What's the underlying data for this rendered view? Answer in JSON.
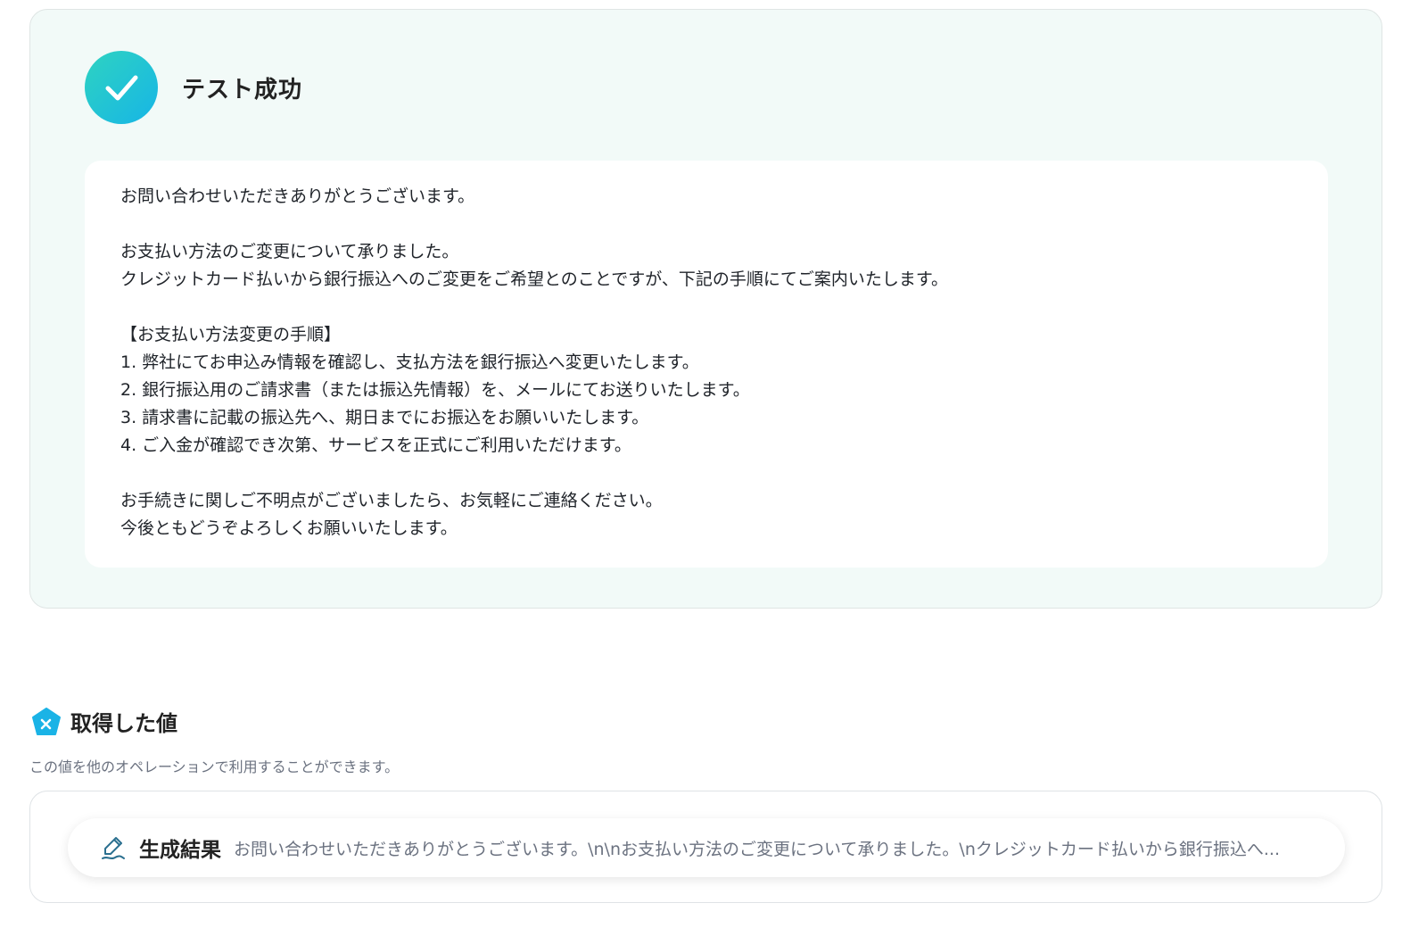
{
  "success": {
    "title": "テスト成功",
    "icon": "check-icon",
    "colors": {
      "gradient_start": "#2ed3c1",
      "gradient_end": "#17b5e6",
      "panel_bg": "#f2faf8"
    }
  },
  "message": {
    "lines": [
      "お問い合わせいただきありがとうございます。",
      "",
      "お支払い方法のご変更について承りました。",
      "クレジットカード払いから銀行振込へのご変更をご希望とのことですが、下記の手順にてご案内いたします。",
      "",
      "【お支払い方法変更の手順】",
      "1. 弊社にてお申込み情報を確認し、支払方法を銀行振込へ変更いたします。",
      "2. 銀行振込用のご請求書（または振込先情報）を、メールにてお送りいたします。",
      "3. 請求書に記載の振込先へ、期日までにお振込をお願いいたします。",
      "4. ご入金が確認でき次第、サービスを正式にご利用いただけます。",
      "",
      "お手続きに関しご不明点がございましたら、お気軽にご連絡ください。",
      "今後ともどうぞよろしくお願いいたします。"
    ]
  },
  "variables": {
    "title": "取得した値",
    "icon": "variable-x-icon",
    "description": "この値を他のオペレーションで利用することができます。",
    "result": {
      "icon": "pen-icon",
      "label": "生成結果",
      "value": "お問い合わせいただきありがとうございます。\\n\\nお支払い方法のご変更について承りました。\\nクレジットカード払いから銀行振込へ..."
    }
  }
}
